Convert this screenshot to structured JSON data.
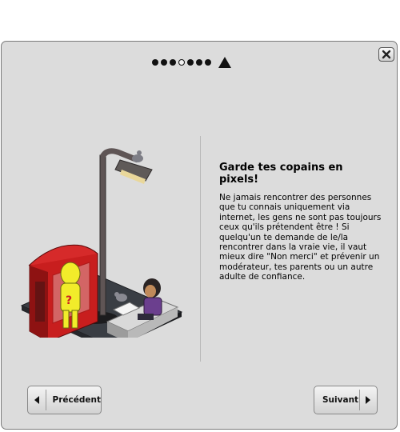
{
  "pager": {
    "total_steps": 7,
    "active_step": 4
  },
  "content": {
    "title": "Garde tes copains en pixels!",
    "body": "Ne jamais rencontrer des personnes que tu connais uniquement via internet, les gens ne sont pas toujours ceux qu'ils prétendent être ! Si quelqu'un te demande de le/la rencontrer dans la vraie vie, il vaut mieux dire \"Non merci\" et prévenir un modérateur, tes parents ou un autre adulte de confiance."
  },
  "buttons": {
    "previous_label": "Précédent",
    "next_label": "Suivant"
  },
  "icons": {
    "close": "close-icon",
    "prev_arrow": "arrow-left-icon",
    "next_arrow": "arrow-right-icon",
    "pager_end": "triangle-icon"
  }
}
